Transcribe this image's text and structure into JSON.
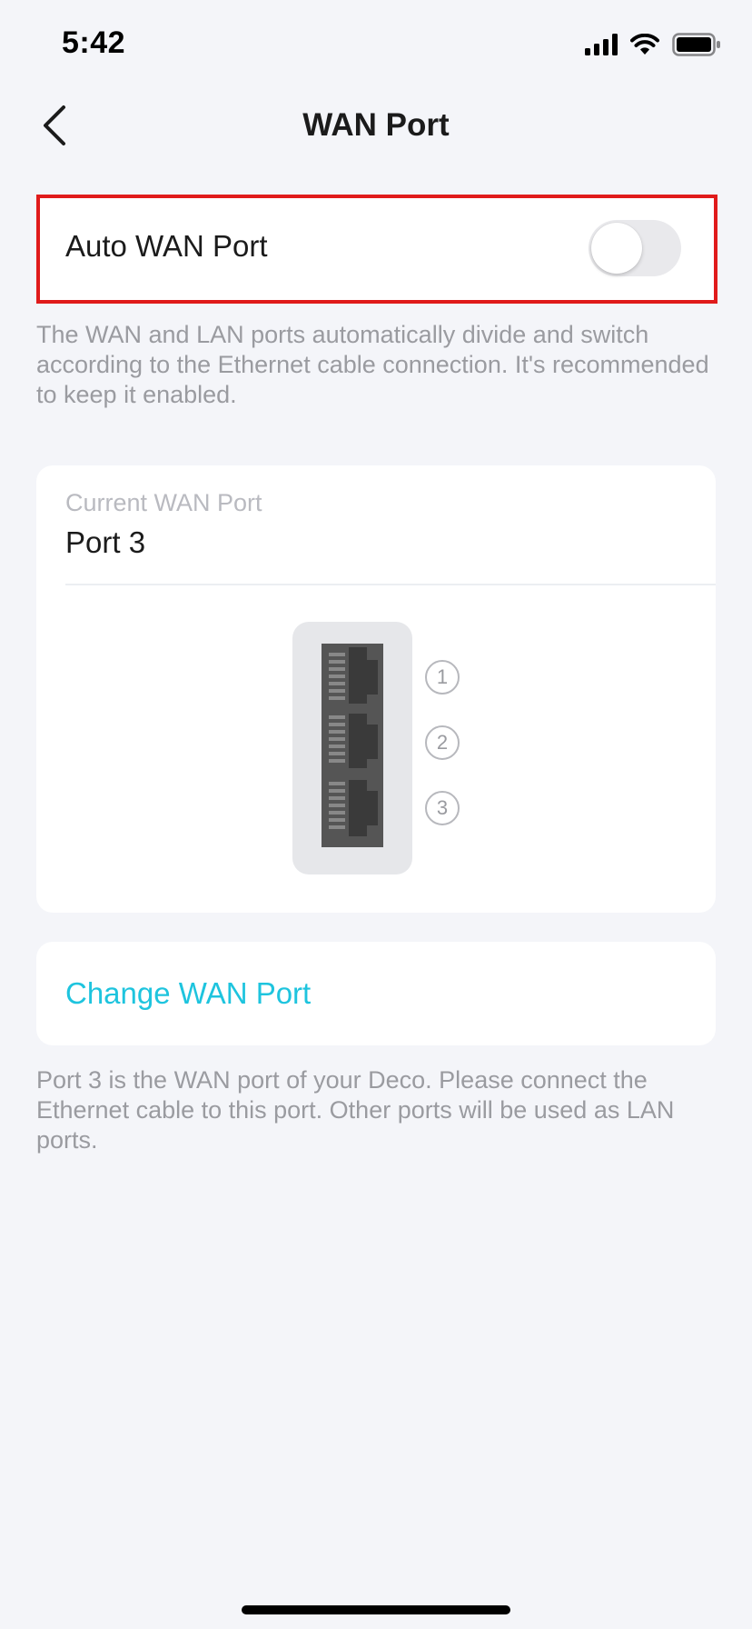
{
  "status_bar": {
    "time": "5:42",
    "icons": [
      "signal-icon",
      "wifi-icon",
      "battery-icon"
    ]
  },
  "nav": {
    "back_icon": "chevron-left-icon",
    "title": "WAN Port"
  },
  "auto_wan": {
    "label": "Auto WAN Port",
    "enabled": false,
    "description": "The WAN and LAN ports automatically divide and switch according to the Ethernet cable connection. It's recommended to keep it enabled."
  },
  "current_wan": {
    "label": "Current WAN Port",
    "value": "Port 3",
    "ports": [
      "1",
      "2",
      "3"
    ]
  },
  "change_wan": {
    "label": "Change WAN Port",
    "note": "Port 3 is the WAN port of your Deco. Please connect the Ethernet cable to this port. Other ports will be used as LAN ports."
  },
  "colors": {
    "accent": "#1ec4de",
    "highlight_border": "#e01b1b",
    "background": "#f4f5f9",
    "port_block": "#555555"
  }
}
